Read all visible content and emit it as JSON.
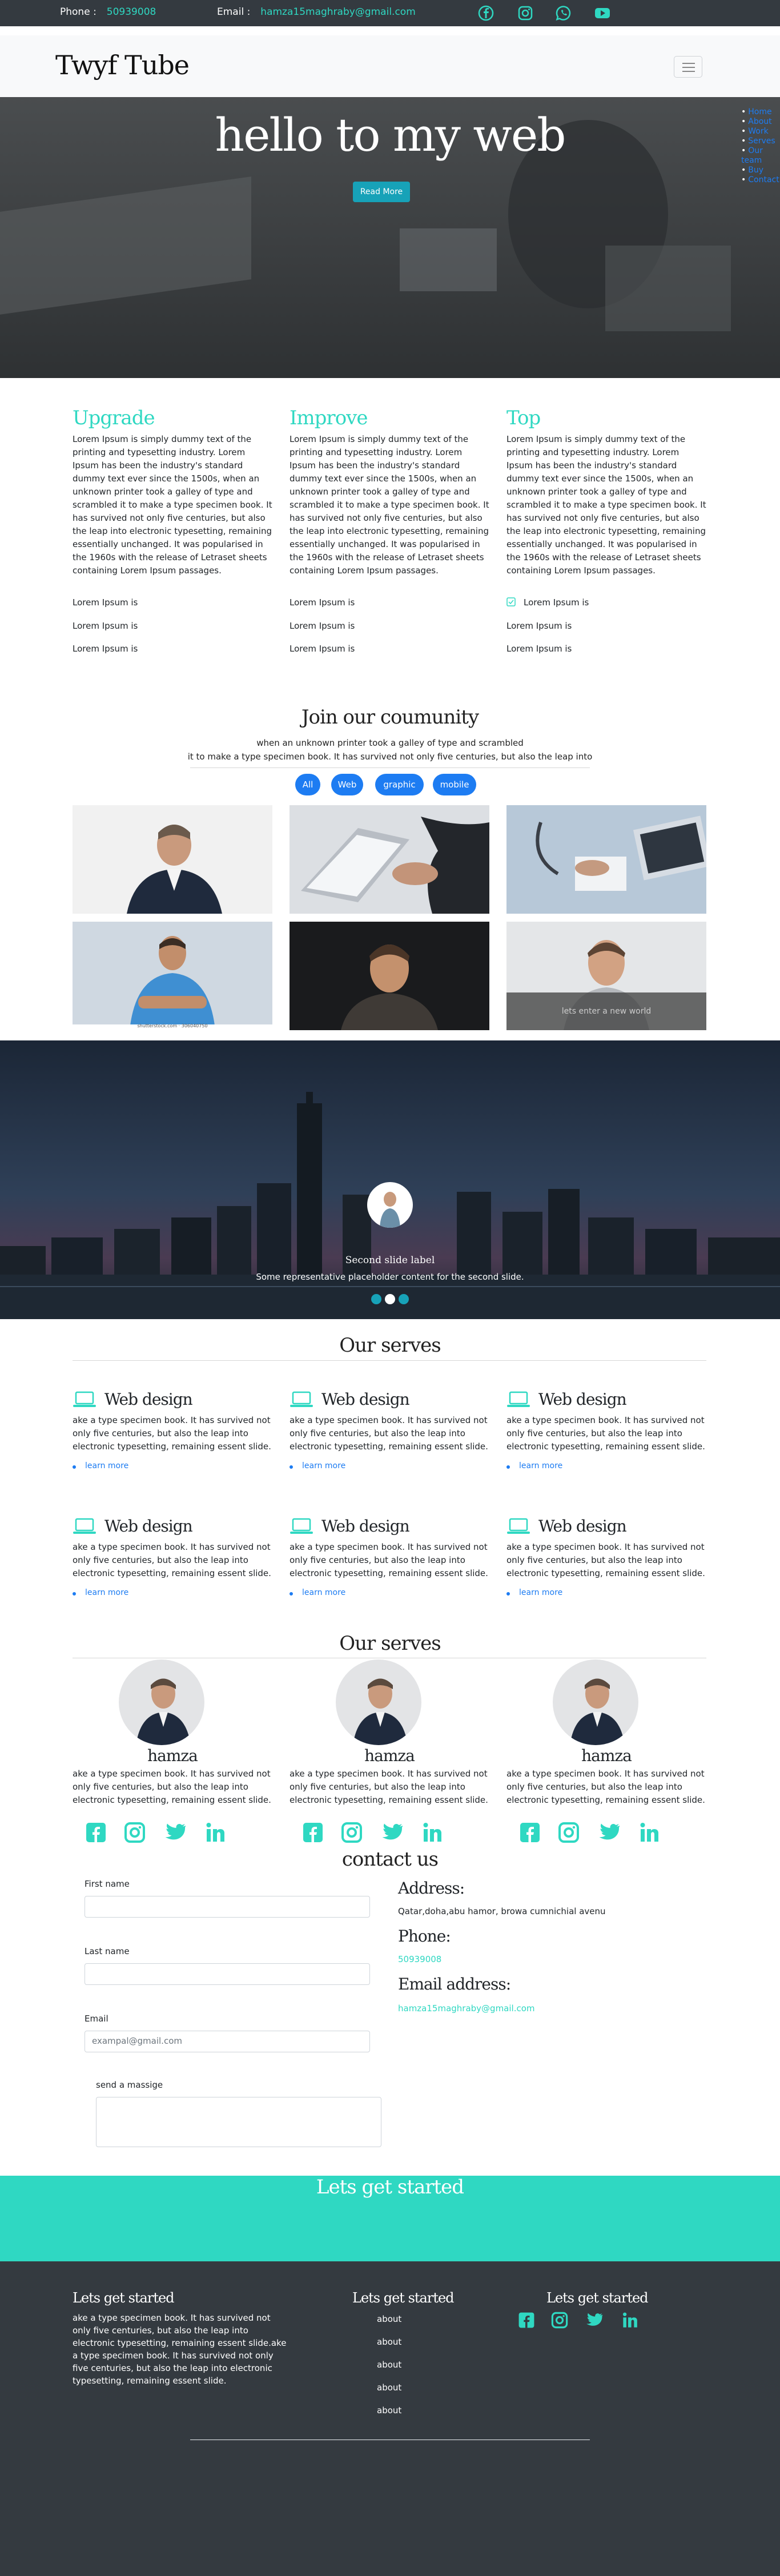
{
  "topbar": {
    "phone_label": "Phone :",
    "phone_value": "50939008",
    "email_label": "Email :",
    "email_value": "hamza15maghraby@gmail.com",
    "social_icons": [
      "facebook-icon",
      "instagram-icon",
      "whatsapp-icon",
      "youtube-icon"
    ],
    "accent_color": "#2fd8c2"
  },
  "navbar": {
    "brand": "Twyf Tube",
    "toggler_icon": "hamburger-icon"
  },
  "hero": {
    "title": "hello to my web",
    "button": "Read More",
    "side_menu": [
      "Home",
      "About",
      "Work",
      "Serves",
      "Our team",
      "Buy",
      "Contact"
    ]
  },
  "features": [
    {
      "title": "Upgrade",
      "text": "Lorem Ipsum is simply dummy text of the printing and typesetting industry. Lorem Ipsum has been the industry's standard dummy text ever since the 1500s, when an unknown printer took a galley of type and scrambled it to make a type specimen book. It has survived not only five centuries, but also the leap into electronic typesetting, remaining essentially unchanged. It was popularised in the 1960s with the release of Letraset sheets containing Lorem Ipsum passages.",
      "items": [
        "Lorem Ipsum is",
        "Lorem Ipsum is",
        "Lorem Ipsum is"
      ]
    },
    {
      "title": "Improve",
      "text": "Lorem Ipsum is simply dummy text of the printing and typesetting industry. Lorem Ipsum has been the industry's standard dummy text ever since the 1500s, when an unknown printer took a galley of type and scrambled it to make a type specimen book. It has survived not only five centuries, but also the leap into electronic typesetting, remaining essentially unchanged. It was popularised in the 1960s with the release of Letraset sheets containing Lorem Ipsum passages.",
      "items": [
        "Lorem Ipsum is",
        "Lorem Ipsum is",
        "Lorem Ipsum is"
      ]
    },
    {
      "title": "Top",
      "text": "Lorem Ipsum is simply dummy text of the printing and typesetting industry. Lorem Ipsum has been the industry's standard dummy text ever since the 1500s, when an unknown printer took a galley of type and scrambled it to make a type specimen book. It has survived not only five centuries, but also the leap into electronic typesetting, remaining essentially unchanged. It was popularised in the 1960s with the release of Letraset sheets containing Lorem Ipsum passages.",
      "items": [
        "Lorem Ipsum is",
        "Lorem Ipsum is",
        "Lorem Ipsum is"
      ]
    }
  ],
  "community": {
    "title": "Join our coumunity",
    "line1": "when an unknown printer took a galley of type and scrambled",
    "line2": "it to make a type specimen book. It has survived not only five centuries, but also the leap into",
    "filters": [
      "All",
      "Web",
      "graphic",
      "mobile"
    ],
    "photo_overlay": "lets enter a new world",
    "photo_watermark": "shutterstock.com · 306040750"
  },
  "carousel": {
    "caption_title": "Second slide label",
    "caption_text": "Some representative placeholder content for the second slide.",
    "slides": 3,
    "active_slide": 2
  },
  "services": {
    "title": "Our serves",
    "items": [
      {
        "title": "Web design",
        "text": "ake a type specimen book. It has survived not only five centuries, but also the leap into electronic typesetting, remaining essent slide.",
        "link": "learn more"
      },
      {
        "title": "Web design",
        "text": "ake a type specimen book. It has survived not only five centuries, but also the leap into electronic typesetting, remaining essent slide.",
        "link": "learn more"
      },
      {
        "title": "Web design",
        "text": "ake a type specimen book. It has survived not only five centuries, but also the leap into electronic typesetting, remaining essent slide.",
        "link": "learn more"
      },
      {
        "title": "Web design",
        "text": "ake a type specimen book. It has survived not only five centuries, but also the leap into electronic typesetting, remaining essent slide.",
        "link": "learn more"
      },
      {
        "title": "Web design",
        "text": "ake a type specimen book. It has survived not only five centuries, but also the leap into electronic typesetting, remaining essent slide.",
        "link": "learn more"
      },
      {
        "title": "Web design",
        "text": "ake a type specimen book. It has survived not only five centuries, but also the leap into electronic typesetting, remaining essent slide.",
        "link": "learn more"
      }
    ]
  },
  "team": {
    "title": "Our serves",
    "members": [
      {
        "name": "hamza",
        "text": "ake a type specimen book. It has survived not only five centuries, but also the leap into electronic typesetting, remaining essent slide."
      },
      {
        "name": "hamza",
        "text": "ake a type specimen book. It has survived not only five centuries, but also the leap into electronic typesetting, remaining essent slide."
      },
      {
        "name": "hamza",
        "text": "ake a type specimen book. It has survived not only five centuries, but also the leap into electronic typesetting, remaining essent slide."
      }
    ],
    "social_icons": [
      "facebook-icon",
      "instagram-icon",
      "twitter-icon",
      "linkedin-icon"
    ]
  },
  "contact": {
    "title": "contact us",
    "first_name_label": "First name",
    "last_name_label": "Last name",
    "email_label": "Email",
    "email_placeholder": "exampal@gmail.com",
    "message_label": "send a massige",
    "address_title": "Address:",
    "address_value": "Qatar,doha,abu hamor, browa cumnichial avenu",
    "phone_title": "Phone:",
    "phone_value": "50939008",
    "email_title": "Email address:",
    "email_value": "hamza15maghraby@gmail.com"
  },
  "cta": {
    "title": "Lets get started"
  },
  "footer": {
    "col1_title": "Lets get started",
    "col1_text": "ake a type specimen book. It has survived not only five centuries, but also the leap into electronic typesetting, remaining essent slide.ake a type specimen book. It has survived not only five centuries, but also the leap into electronic typesetting, remaining essent slide.",
    "col2_title": "Lets get started",
    "col2_links": [
      "about",
      "about",
      "about",
      "about",
      "about"
    ],
    "col3_title": "Lets get started",
    "social_icons": [
      "facebook-icon",
      "instagram-icon",
      "twitter-icon",
      "linkedin-icon"
    ]
  }
}
